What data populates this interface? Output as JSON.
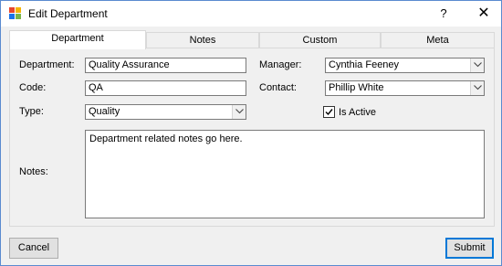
{
  "window": {
    "title": "Edit Department",
    "help_glyph": "?",
    "close_glyph": "✕"
  },
  "tabs": [
    {
      "label": "Department",
      "selected": true
    },
    {
      "label": "Notes",
      "selected": false
    },
    {
      "label": "Custom",
      "selected": false
    },
    {
      "label": "Meta",
      "selected": false
    }
  ],
  "form": {
    "department_label": "Department:",
    "department_value": "Quality Assurance",
    "code_label": "Code:",
    "code_value": "QA",
    "type_label": "Type:",
    "type_value": "Quality",
    "manager_label": "Manager:",
    "manager_value": "Cynthia Feeney",
    "contact_label": "Contact:",
    "contact_value": "Phillip White",
    "is_active_label": "Is Active",
    "is_active_checked": true,
    "notes_label": "Notes:",
    "notes_value": "Department related notes go here."
  },
  "buttons": {
    "cancel_label": "Cancel",
    "submit_label": "Submit"
  },
  "colors": {
    "window_border": "#5a8bd0",
    "default_button_border": "#0078d7",
    "background": "#f0f0f0"
  },
  "icons": {
    "app": "app-icon",
    "help": "help-icon",
    "close": "close-icon",
    "dropdown": "chevron-down-icon",
    "check": "checkmark-icon"
  }
}
